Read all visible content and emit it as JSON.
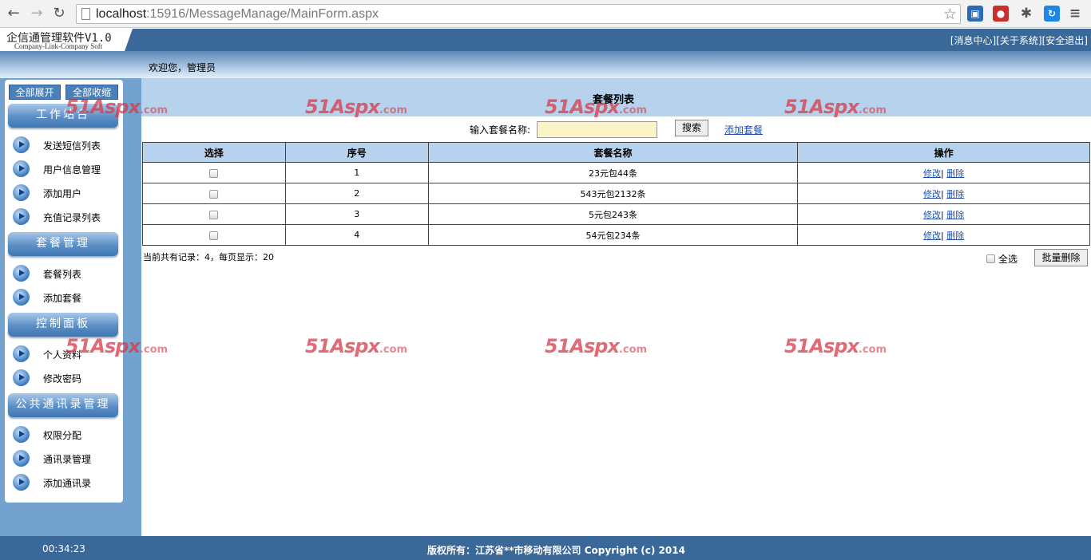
{
  "browser": {
    "url_host": "localhost",
    "url_path": ":15916/MessageManage/MainForm.aspx"
  },
  "header": {
    "title": "企信通管理软件V1.0",
    "subtitle": "Company-Link-Company Soft",
    "links": [
      "[消息中心]",
      "[关于系统]",
      "[安全退出]"
    ]
  },
  "welcome": "欢迎您，管理员",
  "sidebar": {
    "expand_all": "全部展开",
    "collapse_all": "全部收缩",
    "groups": [
      {
        "title": "工作站台",
        "items": [
          "发送短信列表",
          "用户信息管理",
          "添加用户",
          "充值记录列表"
        ]
      },
      {
        "title": "套餐管理",
        "items": [
          "套餐列表",
          "添加套餐"
        ]
      },
      {
        "title": "控制面板",
        "items": [
          "个人资料",
          "修改密码"
        ]
      },
      {
        "title": "公共通讯录管理",
        "items": [
          "权限分配",
          "通讯录管理",
          "添加通讯录"
        ]
      }
    ]
  },
  "main": {
    "title": "套餐列表",
    "search_label": "输入套餐名称:",
    "search_value": "",
    "search_button": "搜索",
    "add_link": "添加套餐",
    "columns": [
      "选择",
      "序号",
      "套餐名称",
      "操作"
    ],
    "rows": [
      {
        "no": "1",
        "name": "23元包44条"
      },
      {
        "no": "2",
        "name": "543元包2132条"
      },
      {
        "no": "3",
        "name": "5元包243条"
      },
      {
        "no": "4",
        "name": "54元包234条"
      }
    ],
    "edit_label": "修改",
    "separator": "|",
    "delete_label": "删除",
    "summary": "当前共有记录：4，每页显示：20",
    "select_all": "全选",
    "batch_delete": "批量删除"
  },
  "watermark": {
    "brand": "51Aspx",
    "domain": ".com"
  },
  "footer": {
    "clock": "00:34:23",
    "copyright": "版权所有：江苏省**市移动有限公司 Copyright (c) 2014"
  }
}
